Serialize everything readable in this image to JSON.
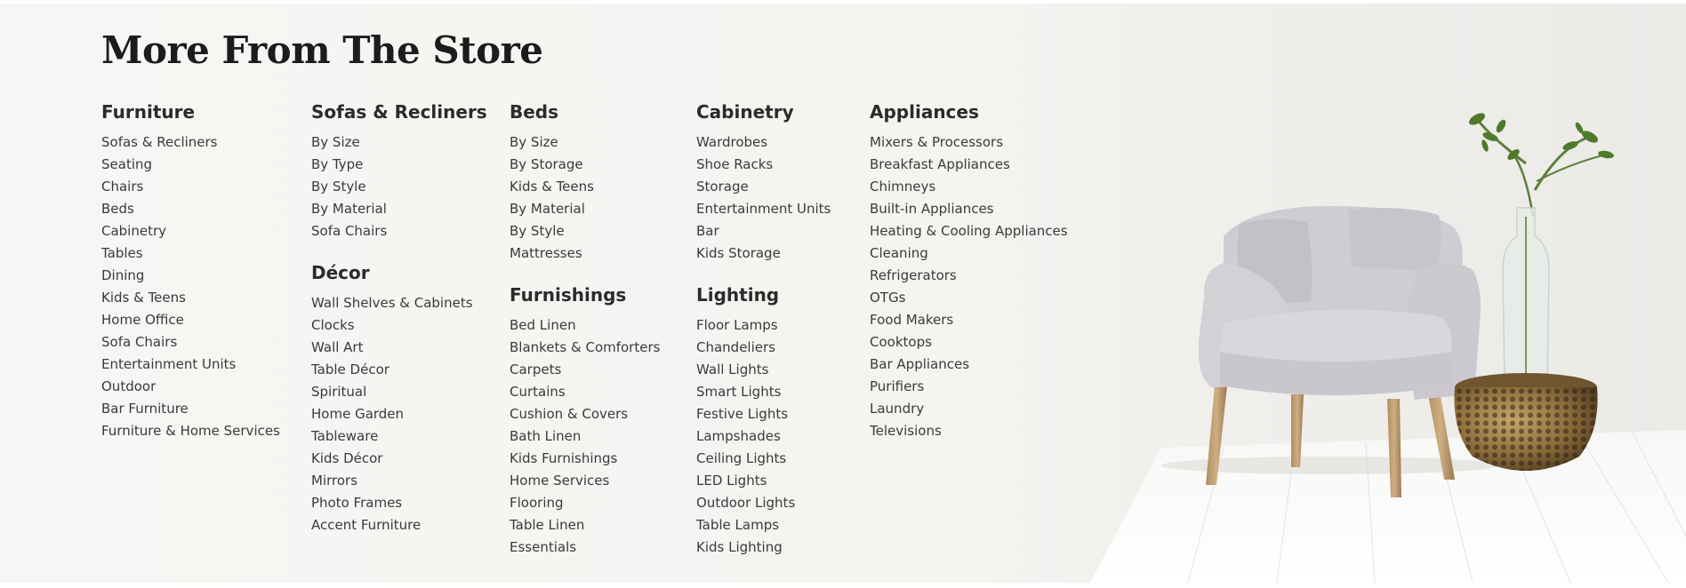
{
  "section": {
    "title": "More From The Store"
  },
  "columns": [
    {
      "groups": [
        {
          "heading": "Furniture",
          "links": [
            "Sofas & Recliners",
            "Seating",
            "Chairs",
            "Beds",
            "Cabinetry",
            "Tables",
            "Dining",
            "Kids & Teens",
            "Home Office",
            "Sofa Chairs",
            "Entertainment Units",
            "Outdoor",
            "Bar Furniture",
            "Furniture & Home Services"
          ]
        }
      ]
    },
    {
      "groups": [
        {
          "heading": "Sofas & Recliners",
          "links": [
            "By Size",
            "By Type",
            "By Style",
            "By Material",
            "Sofa Chairs"
          ]
        },
        {
          "heading": "Décor",
          "links": [
            "Wall Shelves & Cabinets",
            "Clocks",
            "Wall Art",
            "Table Décor",
            "Spiritual",
            "Home Garden",
            "Tableware",
            "Kids Décor",
            "Mirrors",
            "Photo Frames",
            "Accent Furniture"
          ]
        }
      ]
    },
    {
      "groups": [
        {
          "heading": "Beds",
          "links": [
            "By Size",
            "By Storage",
            "Kids & Teens",
            "By Material",
            "By Style",
            "Mattresses"
          ]
        },
        {
          "heading": "Furnishings",
          "links": [
            "Bed Linen",
            "Blankets & Comforters",
            "Carpets",
            "Curtains",
            "Cushion & Covers",
            "Bath Linen",
            "Kids Furnishings",
            "Home Services",
            "Flooring",
            "Table Linen",
            "Essentials"
          ]
        }
      ]
    },
    {
      "groups": [
        {
          "heading": "Cabinetry",
          "links": [
            "Wardrobes",
            "Shoe Racks",
            "Storage",
            "Entertainment Units",
            "Bar",
            "Kids Storage"
          ]
        },
        {
          "heading": "Lighting",
          "links": [
            "Floor Lamps",
            "Chandeliers",
            "Wall Lights",
            "Smart Lights",
            "Festive Lights",
            "Lampshades",
            "Ceiling Lights",
            "LED Lights",
            "Outdoor Lights",
            "Table Lamps",
            "Kids Lighting"
          ]
        }
      ]
    },
    {
      "groups": [
        {
          "heading": "Appliances",
          "links": [
            "Mixers & Processors",
            "Breakfast Appliances",
            "Chimneys",
            "Built-in Appliances",
            "Heating & Cooling Appliances",
            "Cleaning",
            "Refrigerators",
            "OTGs",
            "Food Makers",
            "Cooktops",
            "Bar Appliances",
            "Purifiers",
            "Laundry",
            "Televisions"
          ]
        }
      ]
    }
  ],
  "colors": {
    "background": "#f5f4f1",
    "heading": "#2b2b2b",
    "link": "#3a3a3a",
    "title": "#1c1c1c"
  }
}
